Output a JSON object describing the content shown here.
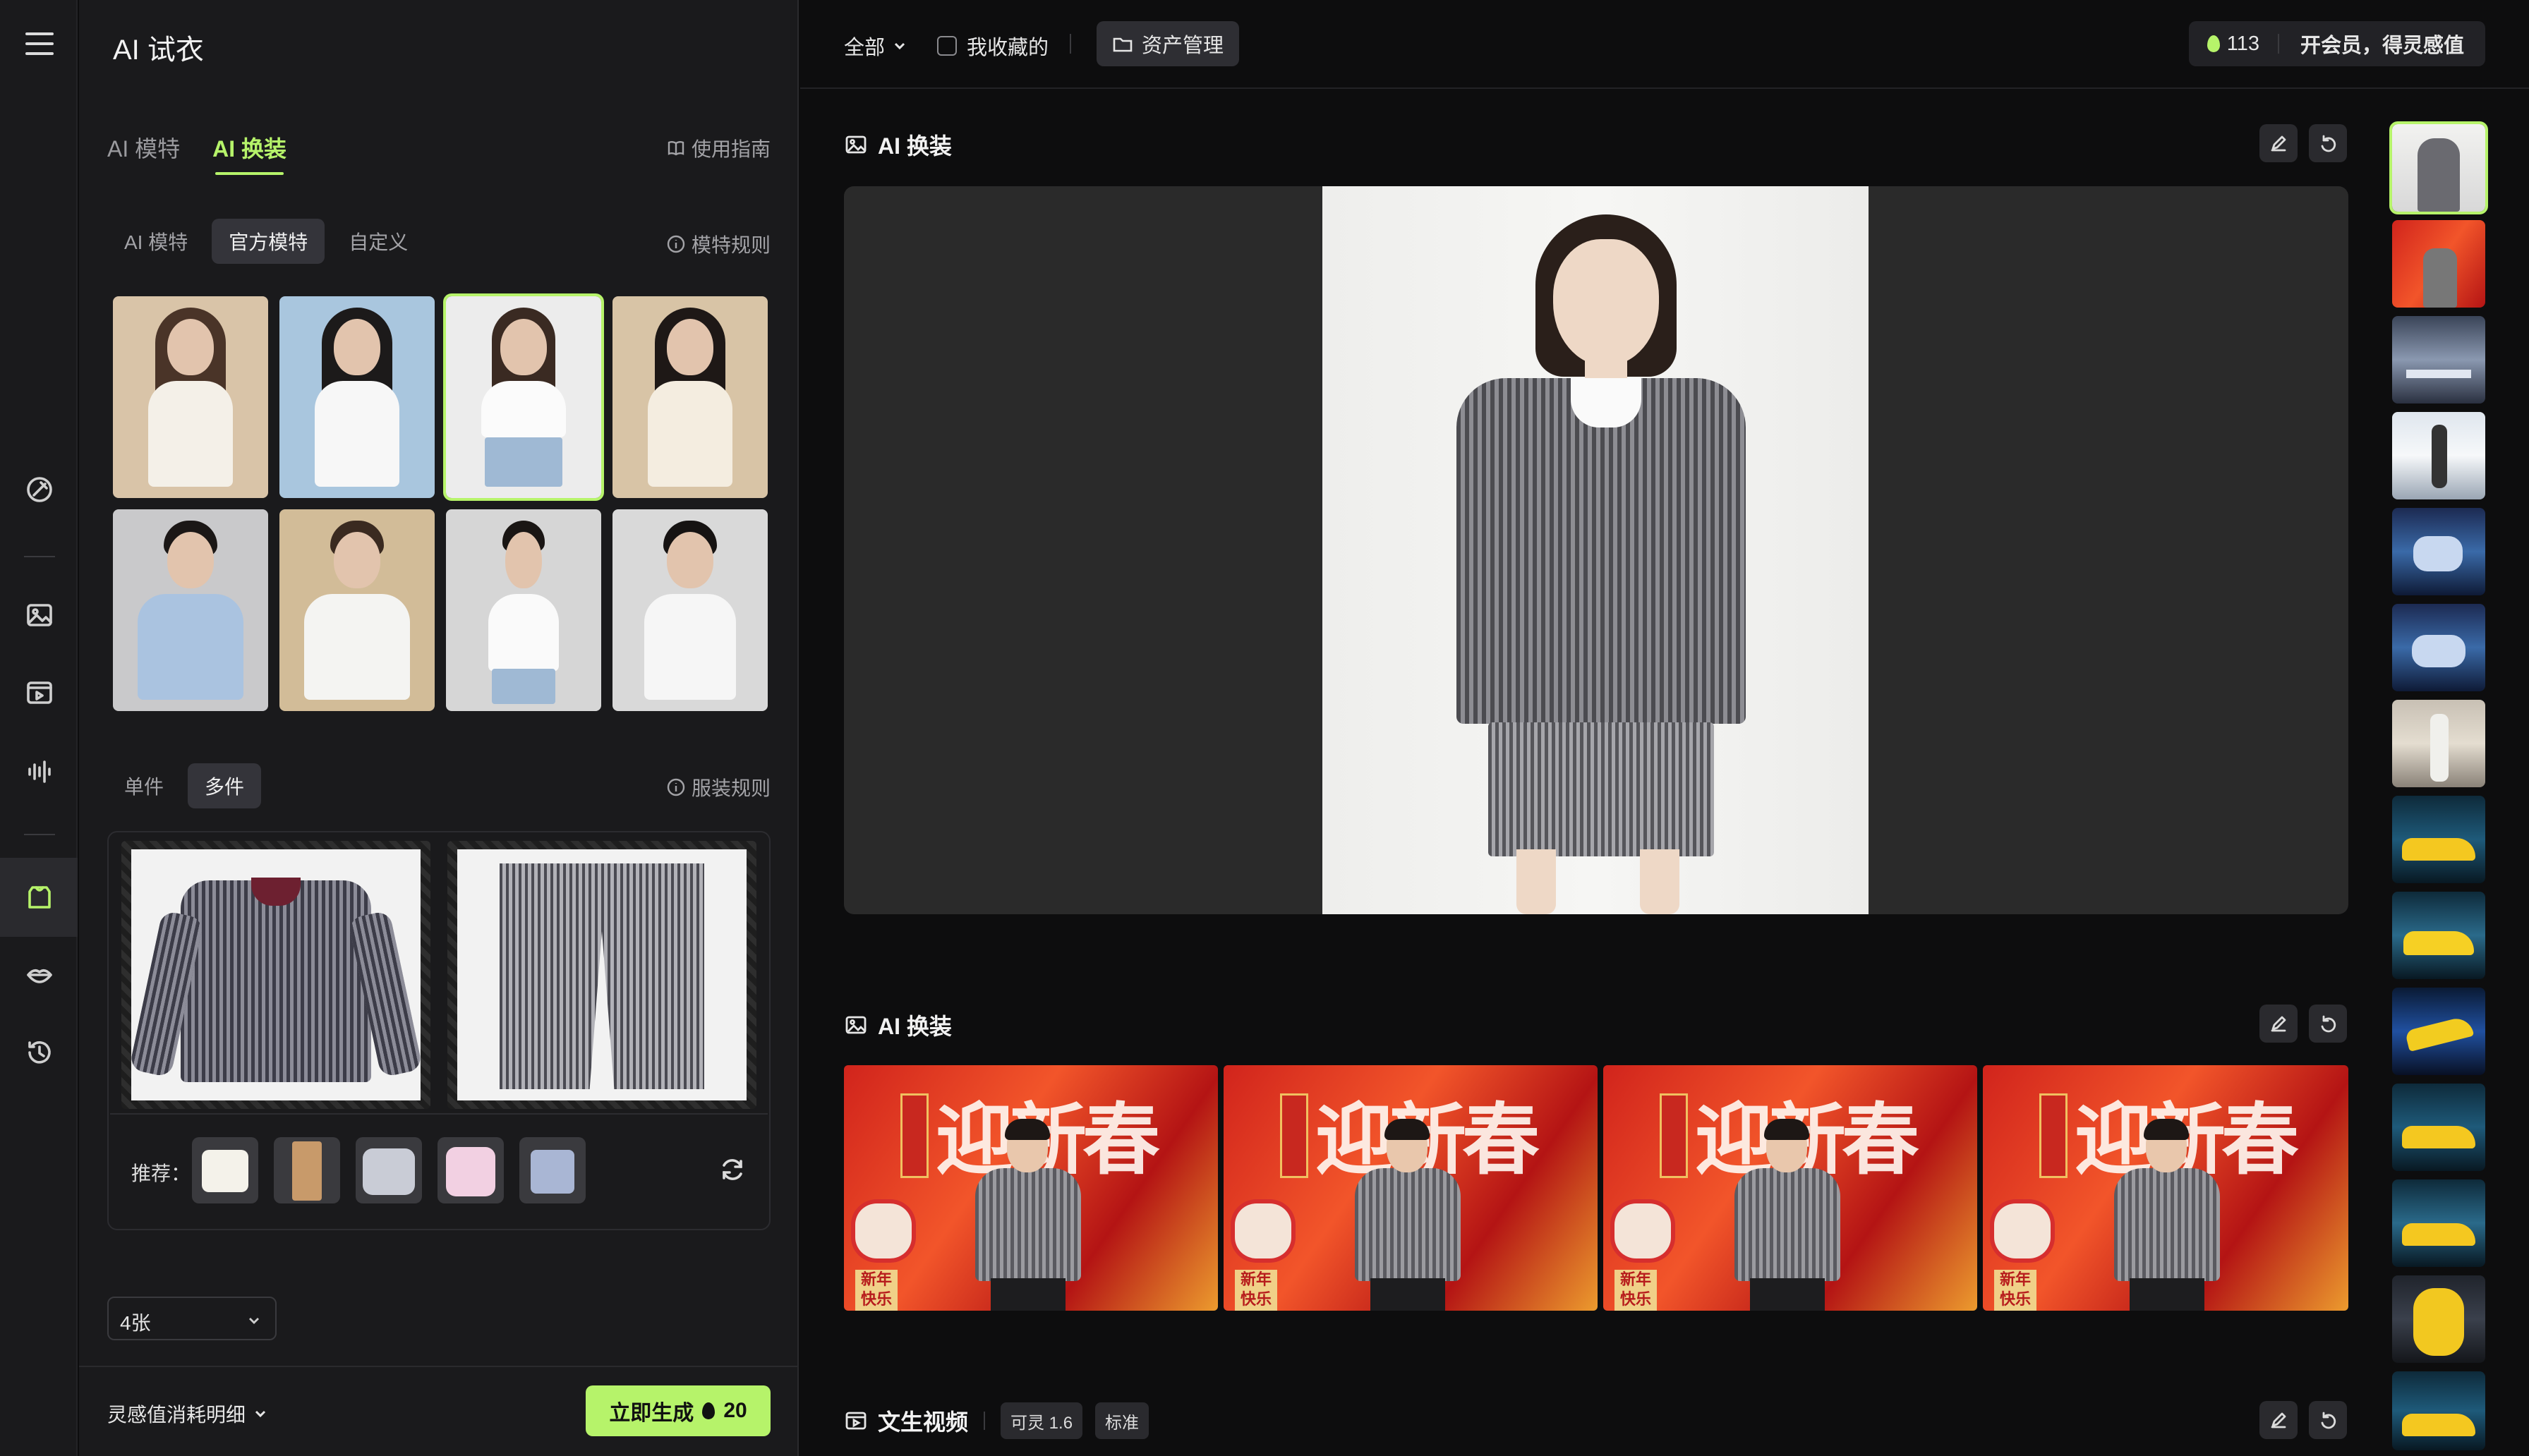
{
  "app": {
    "title": "AI 试衣"
  },
  "panel": {
    "tabs": [
      {
        "label": "AI 模特"
      },
      {
        "label": "AI 换装"
      }
    ],
    "guide_label": "使用指南",
    "model_tabs": [
      {
        "label": "AI 模特"
      },
      {
        "label": "官方模特"
      },
      {
        "label": "自定义"
      }
    ],
    "model_rule": "模特规则",
    "garment_tabs": [
      {
        "label": "单件"
      },
      {
        "label": "多件"
      }
    ],
    "garment_rule": "服装规则",
    "recommend_label": "推荐：",
    "count_select": "4张",
    "cost_detail": "灵感值消耗明细",
    "generate_label": "立即生成",
    "generate_cost": "20"
  },
  "topbar": {
    "filter_all": "全部",
    "favorites": "我收藏的",
    "asset_manage": "资产管理",
    "credits": "113",
    "vip": "开会员，得灵感值"
  },
  "sections": [
    {
      "title": "AI 换装"
    },
    {
      "title": "AI 换装"
    },
    {
      "title": "文生视频",
      "chips": [
        "可灵 1.6",
        "标准"
      ]
    }
  ],
  "banner": {
    "calligraphy": "迎新春",
    "sign": "新年快乐"
  },
  "colors": {
    "accent": "#b6f36a",
    "bg": "#0d0d0e",
    "panel": "#1a1a1c"
  }
}
